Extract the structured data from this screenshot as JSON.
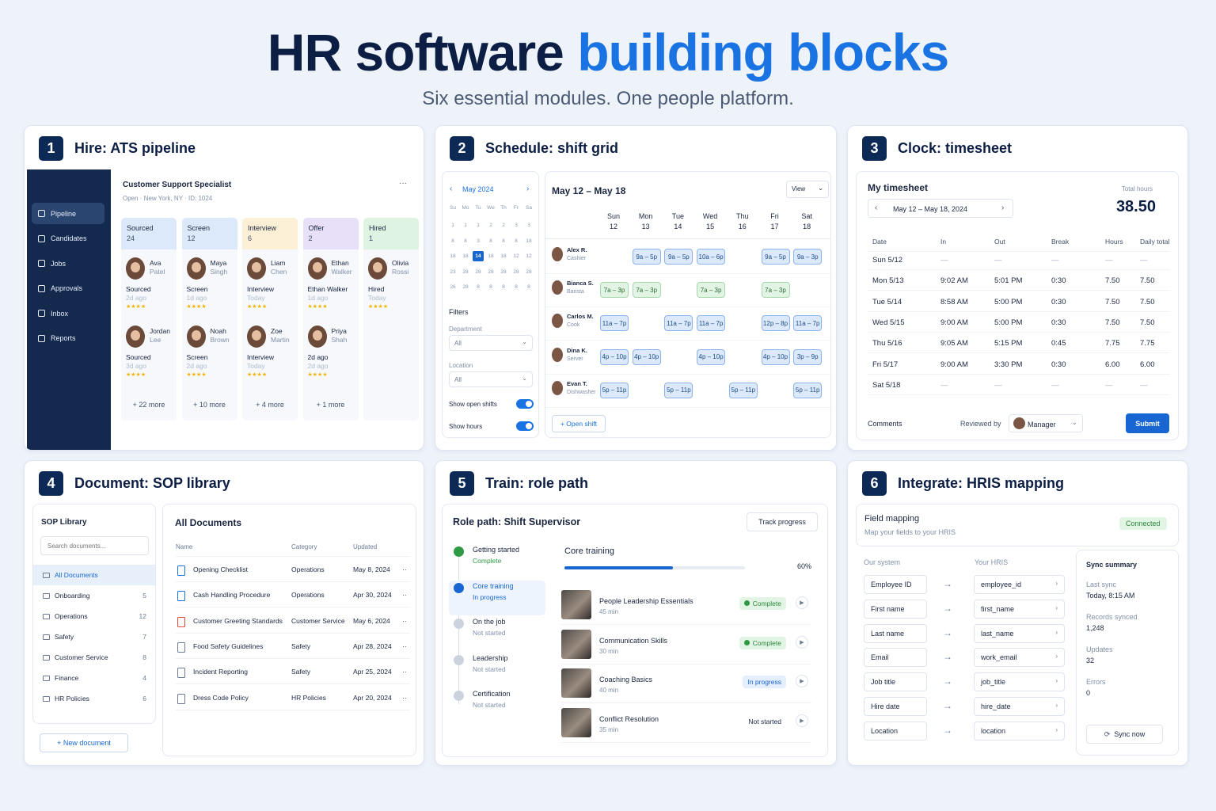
{
  "header": {
    "title_part1": "HR software",
    "title_part2": "building blocks",
    "subtitle": "Six essential modules. One people platform."
  },
  "colors": {
    "accent": "#1a73e2",
    "navy": "#0c2a55",
    "complete_green": "#2e8a3e"
  },
  "card1": {
    "number": "1",
    "title": "Hire: ATS pipeline",
    "nav": [
      "Pipeline",
      "Candidates",
      "Jobs",
      "Approvals",
      "Inbox",
      "Reports"
    ],
    "job_title": "Customer Support Specialist",
    "job_meta": "Open · New York, NY · ID: 1024",
    "menu_icon": "···",
    "columns": [
      {
        "name": "Sourced",
        "count": "24",
        "color": "#dbe9fb",
        "more": "+ 22 more",
        "cands": [
          {
            "first": "Ava",
            "last": "Patel",
            "stage": "Sourced",
            "ago": "2d ago",
            "stars": "★★★★"
          },
          {
            "first": "Jordan",
            "last": "Lee",
            "stage": "Sourced",
            "ago": "3d ago",
            "stars": "★★★★"
          }
        ]
      },
      {
        "name": "Screen",
        "count": "12",
        "color": "#dbe9fb",
        "more": "+ 10 more",
        "cands": [
          {
            "first": "Maya",
            "last": "Singh",
            "stage": "Screen",
            "ago": "1d ago",
            "stars": "★★★★"
          },
          {
            "first": "Noah",
            "last": "Brown",
            "stage": "Screen",
            "ago": "2d ago",
            "stars": "★★★★"
          }
        ]
      },
      {
        "name": "Interview",
        "count": "6",
        "color": "#fbefd6",
        "more": "+ 4 more",
        "cands": [
          {
            "first": "Liam",
            "last": "Chen",
            "stage": "Interview",
            "ago": "Today",
            "stars": "★★★★"
          },
          {
            "first": "Zoe",
            "last": "Martin",
            "stage": "Interview",
            "ago": "Today",
            "stars": "★★★★"
          }
        ]
      },
      {
        "name": "Offer",
        "count": "2",
        "color": "#e8e0f8",
        "more": "+ 1 more",
        "cands": [
          {
            "first": "Ethan",
            "last": "Walker",
            "stage": "Ethan Walker",
            "ago": "1d ago",
            "stars": "★★★★"
          },
          {
            "first": "Priya",
            "last": "Shah",
            "stage": "2d ago",
            "ago": "2d ago",
            "stars": "★★★★"
          }
        ]
      },
      {
        "name": "Hired",
        "count": "1",
        "color": "#dff3e3",
        "more": "",
        "cands": [
          {
            "first": "Olivia",
            "last": "Rossi",
            "stage": "Hired",
            "ago": "Today",
            "stars": "★★★★"
          }
        ]
      }
    ]
  },
  "card2": {
    "number": "2",
    "title": "Schedule: shift grid",
    "month": "May 2024",
    "prev": "‹",
    "next": "›",
    "weekdays": [
      "Su",
      "Mo",
      "Tu",
      "We",
      "Th",
      "Fr",
      "Sa"
    ],
    "cal_rows": [
      [
        "1",
        "1",
        "1",
        "2",
        "2",
        "3",
        "3"
      ],
      [
        "8",
        "8",
        "3",
        "8",
        "8",
        "8",
        "18"
      ],
      [
        "18",
        "18",
        "14",
        "18",
        "18",
        "12",
        "12"
      ],
      [
        "23",
        "28",
        "28",
        "28",
        "28",
        "28",
        "28"
      ],
      [
        "26",
        "28",
        "8",
        "8",
        "8",
        "8",
        "8"
      ]
    ],
    "today": "14",
    "filters_label": "Filters",
    "department_label": "Department",
    "department_value": "All",
    "location_label": "Location",
    "location_value": "All",
    "show_open_shifts": "Show open shifts",
    "show_hours": "Show hours",
    "week_range": "May 12 – May 18",
    "view_label": "View",
    "days": [
      {
        "d": "Sun",
        "n": "12"
      },
      {
        "d": "Mon",
        "n": "13"
      },
      {
        "d": "Tue",
        "n": "14"
      },
      {
        "d": "Wed",
        "n": "15"
      },
      {
        "d": "Thu",
        "n": "16"
      },
      {
        "d": "Fri",
        "n": "17"
      },
      {
        "d": "Sat",
        "n": "18"
      }
    ],
    "staff": [
      {
        "name": "Alex R.",
        "role": "Cashier",
        "shifts": [
          "",
          "9a – 5p",
          "9a – 5p",
          "10a – 6p",
          "",
          "9a – 5p",
          "9a – 3p"
        ],
        "kinds": [
          "",
          "b",
          "b",
          "b",
          "",
          "b",
          "b"
        ]
      },
      {
        "name": "Bianca S.",
        "role": "Barista",
        "shifts": [
          "7a – 3p",
          "7a – 3p",
          "",
          "7a – 3p",
          "",
          "7a – 3p",
          ""
        ],
        "kinds": [
          "g",
          "g",
          "",
          "g",
          "",
          "g",
          ""
        ]
      },
      {
        "name": "Carlos M.",
        "role": "Cook",
        "shifts": [
          "11a – 7p",
          "",
          "11a – 7p",
          "11a – 7p",
          "",
          "12p – 8p",
          "11a – 7p"
        ],
        "kinds": [
          "b",
          "",
          "b",
          "b",
          "",
          "b",
          "b"
        ]
      },
      {
        "name": "Dina K.",
        "role": "Server",
        "shifts": [
          "4p – 10p",
          "4p – 10p",
          "",
          "4p – 10p",
          "",
          "4p – 10p",
          "3p – 9p"
        ],
        "kinds": [
          "b",
          "b",
          "",
          "b",
          "",
          "b",
          "b"
        ]
      },
      {
        "name": "Evan T.",
        "role": "Dishwasher",
        "shifts": [
          "5p – 11p",
          "",
          "5p – 11p",
          "",
          "5p – 11p",
          "",
          "5p – 11p"
        ],
        "kinds": [
          "b",
          "",
          "b",
          "",
          "b",
          "",
          "b"
        ]
      }
    ],
    "open_shift": "+ Open shift"
  },
  "card3": {
    "number": "3",
    "title": "Clock: timesheet",
    "heading": "My timesheet",
    "range": "May 12 – May 18, 2024",
    "total_label": "Total hours",
    "total_value": "38.50",
    "columns": [
      "Date",
      "In",
      "Out",
      "Break",
      "Hours",
      "Daily total"
    ],
    "rows": [
      [
        "Sun 5/12",
        "—",
        "—",
        "—",
        "—",
        "—"
      ],
      [
        "Mon 5/13",
        "9:02 AM",
        "5:01 PM",
        "0:30",
        "7.50",
        "7.50"
      ],
      [
        "Tue 5/14",
        "8:58 AM",
        "5:00 PM",
        "0:30",
        "7.50",
        "7.50"
      ],
      [
        "Wed 5/15",
        "9:00 AM",
        "5:00 PM",
        "0:30",
        "7.50",
        "7.50"
      ],
      [
        "Thu 5/16",
        "9:05 AM",
        "5:15 PM",
        "0:45",
        "7.75",
        "7.75"
      ],
      [
        "Fri 5/17",
        "9:00 AM",
        "3:30 PM",
        "0:30",
        "6.00",
        "6.00"
      ],
      [
        "Sat 5/18",
        "—",
        "—",
        "—",
        "—",
        "—"
      ]
    ],
    "comments": "Comments",
    "reviewed_by": "Reviewed by",
    "reviewer": "Manager",
    "submit": "Submit"
  },
  "card4": {
    "number": "4",
    "title": "Document: SOP library",
    "lib_title": "SOP Library",
    "search_placeholder": "Search documents...",
    "folders": [
      {
        "name": "All Documents",
        "count": ""
      },
      {
        "name": "Onboarding",
        "count": "5"
      },
      {
        "name": "Operations",
        "count": "12"
      },
      {
        "name": "Safety",
        "count": "7"
      },
      {
        "name": "Customer Service",
        "count": "8"
      },
      {
        "name": "Finance",
        "count": "4"
      },
      {
        "name": "HR Policies",
        "count": "6"
      }
    ],
    "new_doc": "+ New document",
    "all_docs": "All Documents",
    "columns": [
      "Name",
      "Category",
      "Updated"
    ],
    "docs": [
      {
        "name": "Opening Checklist",
        "cat": "Operations",
        "date": "May 8, 2024",
        "icon": "blue"
      },
      {
        "name": "Cash Handling Procedure",
        "cat": "Operations",
        "date": "Apr 30, 2024",
        "icon": "blue"
      },
      {
        "name": "Customer Greeting Standards",
        "cat": "Customer Service",
        "date": "May 6, 2024",
        "icon": "red"
      },
      {
        "name": "Food Safety Guidelines",
        "cat": "Safety",
        "date": "Apr 28, 2024",
        "icon": "gray"
      },
      {
        "name": "Incident Reporting",
        "cat": "Safety",
        "date": "Apr 25, 2024",
        "icon": "gray"
      },
      {
        "name": "Dress Code Policy",
        "cat": "HR Policies",
        "date": "Apr 20, 2024",
        "icon": "gray"
      }
    ],
    "row_menu": "··"
  },
  "card5": {
    "number": "5",
    "title": "Train: role path",
    "path_title": "Role path: Shift Supervisor",
    "track": "Track progress",
    "steps": [
      {
        "t": "Getting started",
        "s": "Complete",
        "state": "done"
      },
      {
        "t": "Core training",
        "s": "In progress",
        "state": "active"
      },
      {
        "t": "On the job",
        "s": "Not started",
        "state": "todo"
      },
      {
        "t": "Leadership",
        "s": "Not started",
        "state": "todo"
      },
      {
        "t": "Certification",
        "s": "Not started",
        "state": "todo"
      }
    ],
    "core_title": "Core training",
    "progress_pct": 60,
    "progress_label": "60%",
    "courses": [
      {
        "name": "People Leadership Essentials",
        "dur": "45 min",
        "status": "Complete",
        "kind": "complete"
      },
      {
        "name": "Communication Skills",
        "dur": "30 min",
        "status": "Complete",
        "kind": "complete"
      },
      {
        "name": "Coaching Basics",
        "dur": "40 min",
        "status": "In progress",
        "kind": "progress"
      },
      {
        "name": "Conflict Resolution",
        "dur": "35 min",
        "status": "Not started",
        "kind": "none"
      }
    ],
    "play": "▶"
  },
  "card6": {
    "number": "6",
    "title": "Integrate: HRIS mapping",
    "fm_title": "Field mapping",
    "fm_sub": "Map your fields to your HRIS",
    "status": "Connected",
    "our_system": "Our system",
    "your_hris": "Your HRIS",
    "mappings": [
      [
        "Employee ID",
        "employee_id"
      ],
      [
        "First name",
        "first_name"
      ],
      [
        "Last name",
        "last_name"
      ],
      [
        "Email",
        "work_email"
      ],
      [
        "Job title",
        "job_title"
      ],
      [
        "Hire date",
        "hire_date"
      ],
      [
        "Location",
        "location"
      ]
    ],
    "arrow": "→",
    "chev": "›",
    "sync_title": "Sync summary",
    "last_sync_label": "Last sync",
    "last_sync_value": "Today, 8:15 AM",
    "records_label": "Records synced",
    "records_value": "1,248",
    "updates_label": "Updates",
    "updates_value": "32",
    "errors_label": "Errors",
    "errors_value": "0",
    "sync_now": "Sync now"
  }
}
